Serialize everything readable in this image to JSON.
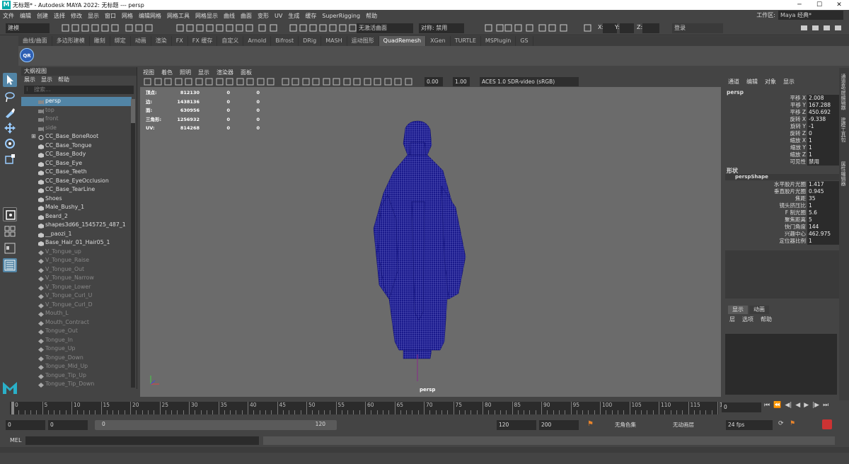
{
  "title": {
    "icon": "M",
    "text": "无标题* - Autodesk MAYA 2022: 无标题   ---   persp",
    "min": "─",
    "max": "☐",
    "close": "✕"
  },
  "menu": [
    "文件",
    "编辑",
    "创建",
    "选择",
    "修改",
    "显示",
    "窗口",
    "网格",
    "编辑网格",
    "网格工具",
    "网格显示",
    "曲线",
    "曲面",
    "变形",
    "UV",
    "生成",
    "缓存",
    "SuperRigging",
    "帮助"
  ],
  "workspace": {
    "label": "工作区:",
    "value": "Maya 经典*"
  },
  "status": {
    "mode": "建模",
    "no_live": "无激活曲面",
    "symmetry": "对称: 禁用",
    "x": "X:",
    "y": "Y:",
    "z": "Z:",
    "login": "登录"
  },
  "shelf_tabs": [
    "曲线/曲面",
    "多边形建模",
    "雕刻",
    "绑定",
    "动画",
    "渲染",
    "FX",
    "FX 缓存",
    "自定义",
    "Arnold",
    "Bifrost",
    "DRig",
    "MASH",
    "运动图形",
    "QuadRemesh",
    "XGen",
    "TURTLE",
    "MSPlugin",
    "GS"
  ],
  "shelf_active": "QuadRemesh",
  "shelf_icon": "QR",
  "outliner": {
    "title": "大纲视图",
    "menu": [
      "展示",
      "显示",
      "帮助"
    ],
    "search": "搜索...",
    "items": [
      {
        "label": "persp",
        "kind": "cam",
        "sel": true,
        "dim": false
      },
      {
        "label": "top",
        "kind": "cam",
        "sel": false,
        "dim": true
      },
      {
        "label": "front",
        "kind": "cam",
        "sel": false,
        "dim": true
      },
      {
        "label": "side",
        "kind": "cam",
        "sel": false,
        "dim": true
      },
      {
        "label": "CC_Base_BoneRoot",
        "kind": "joint",
        "sel": false,
        "dim": false
      },
      {
        "label": "CC_Base_Tongue",
        "kind": "mesh",
        "sel": false,
        "dim": false
      },
      {
        "label": "CC_Base_Body",
        "kind": "mesh",
        "sel": false,
        "dim": false
      },
      {
        "label": "CC_Base_Eye",
        "kind": "mesh",
        "sel": false,
        "dim": false
      },
      {
        "label": "CC_Base_Teeth",
        "kind": "mesh",
        "sel": false,
        "dim": false
      },
      {
        "label": "CC_Base_EyeOcclusion",
        "kind": "mesh",
        "sel": false,
        "dim": false
      },
      {
        "label": "CC_Base_TearLine",
        "kind": "mesh",
        "sel": false,
        "dim": false
      },
      {
        "label": "Shoes",
        "kind": "mesh",
        "sel": false,
        "dim": false
      },
      {
        "label": "Male_Bushy_1",
        "kind": "mesh",
        "sel": false,
        "dim": false
      },
      {
        "label": "Beard_2",
        "kind": "mesh",
        "sel": false,
        "dim": false
      },
      {
        "label": "shapes3d66_1545725_487_1",
        "kind": "mesh",
        "sel": false,
        "dim": false
      },
      {
        "label": "__paozi_1",
        "kind": "mesh",
        "sel": false,
        "dim": false
      },
      {
        "label": "Base_Hair_01_Hair05_1",
        "kind": "mesh",
        "sel": false,
        "dim": false
      },
      {
        "label": "V_Tongue_up",
        "kind": "blend",
        "sel": false,
        "dim": true
      },
      {
        "label": "V_Tongue_Raise",
        "kind": "blend",
        "sel": false,
        "dim": true
      },
      {
        "label": "V_Tongue_Out",
        "kind": "blend",
        "sel": false,
        "dim": true
      },
      {
        "label": "V_Tongue_Narrow",
        "kind": "blend",
        "sel": false,
        "dim": true
      },
      {
        "label": "V_Tongue_Lower",
        "kind": "blend",
        "sel": false,
        "dim": true
      },
      {
        "label": "V_Tongue_Curl_U",
        "kind": "blend",
        "sel": false,
        "dim": true
      },
      {
        "label": "V_Tongue_Curl_D",
        "kind": "blend",
        "sel": false,
        "dim": true
      },
      {
        "label": "Mouth_L",
        "kind": "blend",
        "sel": false,
        "dim": true
      },
      {
        "label": "Mouth_Contract",
        "kind": "blend",
        "sel": false,
        "dim": true
      },
      {
        "label": "Tongue_Out",
        "kind": "blend",
        "sel": false,
        "dim": true
      },
      {
        "label": "Tongue_In",
        "kind": "blend",
        "sel": false,
        "dim": true
      },
      {
        "label": "Tongue_Up",
        "kind": "blend",
        "sel": false,
        "dim": true
      },
      {
        "label": "Tongue_Down",
        "kind": "blend",
        "sel": false,
        "dim": true
      },
      {
        "label": "Tongue_Mid_Up",
        "kind": "blend",
        "sel": false,
        "dim": true
      },
      {
        "label": "Tongue_Tip_Up",
        "kind": "blend",
        "sel": false,
        "dim": true
      },
      {
        "label": "Tongue_Tip_Down",
        "kind": "blend",
        "sel": false,
        "dim": true
      }
    ]
  },
  "viewport": {
    "menu": [
      "视图",
      "着色",
      "照明",
      "显示",
      "渲染器",
      "面板"
    ],
    "exposure": "0.00",
    "gamma": "1.00",
    "colorspace": "ACES 1.0 SDR-video (sRGB)",
    "camera": "persp",
    "hud": [
      {
        "label": "顶点:",
        "a": "812130",
        "b": "0",
        "c": "0"
      },
      {
        "label": "边:",
        "a": "1438136",
        "b": "0",
        "c": "0"
      },
      {
        "label": "面:",
        "a": "630956",
        "b": "0",
        "c": "0"
      },
      {
        "label": "三角形:",
        "a": "1256932",
        "b": "0",
        "c": "0"
      },
      {
        "label": "UV:",
        "a": "814268",
        "b": "0",
        "c": "0"
      }
    ],
    "mesh_color": "#1a1a8c"
  },
  "channel": {
    "menu": [
      "通道",
      "编辑",
      "对象",
      "显示"
    ],
    "node": "persp",
    "attrs": [
      {
        "label": "平移 X",
        "value": "2.008"
      },
      {
        "label": "平移 Y",
        "value": "167.288"
      },
      {
        "label": "平移 Z",
        "value": "450.692"
      },
      {
        "label": "旋转 X",
        "value": "-9.338"
      },
      {
        "label": "旋转 Y",
        "value": "-1"
      },
      {
        "label": "旋转 Z",
        "value": "0"
      },
      {
        "label": "缩放 X",
        "value": "1"
      },
      {
        "label": "缩放 Y",
        "value": "1"
      },
      {
        "label": "缩放 Z",
        "value": "1"
      },
      {
        "label": "可见性",
        "value": "禁用"
      }
    ],
    "shapes_title": "形状",
    "shape": "perspShape",
    "shape_attrs": [
      {
        "label": "水平胶片光圈",
        "value": "1.417"
      },
      {
        "label": "垂直胶片光圈",
        "value": "0.945"
      },
      {
        "label": "焦距",
        "value": "35"
      },
      {
        "label": "镜头挤压比",
        "value": "1"
      },
      {
        "label": "F 制光圈",
        "value": "5.6"
      },
      {
        "label": "聚焦距离",
        "value": "5"
      },
      {
        "label": "快门角度",
        "value": "144"
      },
      {
        "label": "兴趣中心",
        "value": "462.975"
      },
      {
        "label": "定位器比例",
        "value": "1"
      }
    ],
    "layer_tabs": [
      "显示",
      "动画"
    ],
    "layer_menu": [
      "层",
      "选项",
      "帮助"
    ]
  },
  "side_tabs": [
    "通道盒/层编辑器",
    "建模工具包",
    "属性编辑器"
  ],
  "timeline": {
    "ticks": [
      "0",
      "5",
      "10",
      "15",
      "20",
      "25",
      "30",
      "35",
      "40",
      "45",
      "50",
      "55",
      "60",
      "65",
      "70",
      "75",
      "80",
      "85",
      "90",
      "95",
      "100",
      "105",
      "110",
      "115",
      "120"
    ],
    "current": "0"
  },
  "range": {
    "start": "0",
    "start2": "0",
    "slider_start": "0",
    "slider_end": "120",
    "end": "120",
    "end2": "200",
    "char_set": "无角色集",
    "anim_layer": "无动画层",
    "fps": "24 fps"
  },
  "cmd": {
    "lang": "MEL"
  }
}
